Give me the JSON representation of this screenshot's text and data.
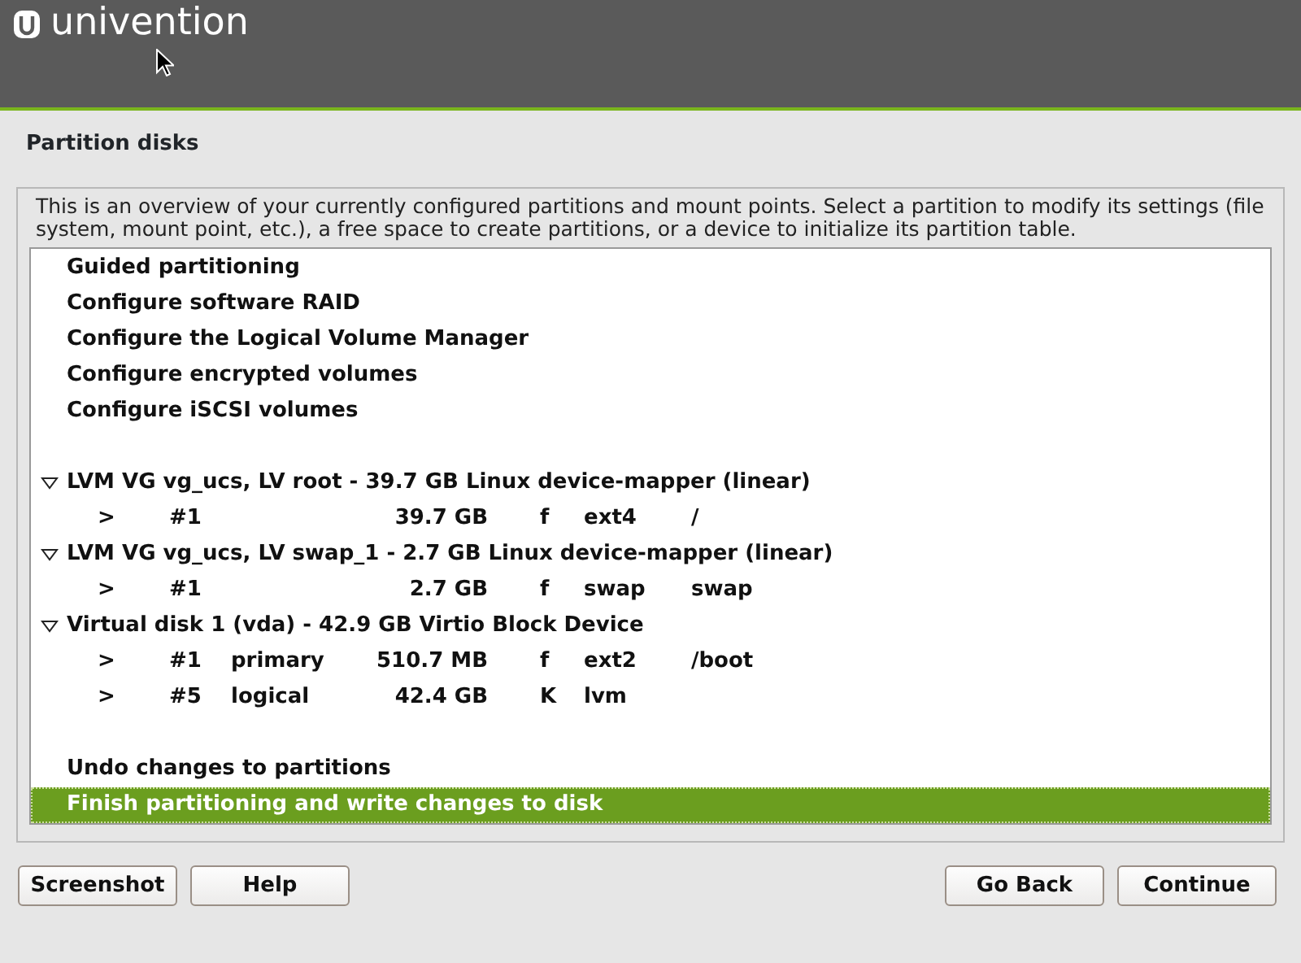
{
  "header": {
    "logo_text": "univention"
  },
  "title": "Partition disks",
  "description": "This is an overview of your currently configured partitions and mount points. Select a partition to modify its settings (file system, mount point, etc.), a free space to create partitions, or a device to initialize its partition table.",
  "items": [
    {
      "kind": "action",
      "label": "Guided partitioning",
      "selected": false
    },
    {
      "kind": "action",
      "label": "Configure software RAID",
      "selected": false
    },
    {
      "kind": "action",
      "label": "Configure the Logical Volume Manager",
      "selected": false
    },
    {
      "kind": "action",
      "label": "Configure encrypted volumes",
      "selected": false
    },
    {
      "kind": "action",
      "label": "Configure iSCSI volumes",
      "selected": false
    },
    {
      "kind": "blank"
    },
    {
      "kind": "device",
      "label": "LVM VG vg_ucs, LV root - 39.7 GB Linux device-mapper (linear)",
      "expanded": true,
      "selected": false
    },
    {
      "kind": "partition",
      "arrow": ">",
      "number": "#1",
      "size": "39.7 GB",
      "flag": "f",
      "fs": "ext4",
      "mount": "/",
      "selected": false
    },
    {
      "kind": "device",
      "label": "LVM VG vg_ucs, LV swap_1 - 2.7 GB Linux device-mapper (linear)",
      "expanded": true,
      "selected": false
    },
    {
      "kind": "partition",
      "arrow": ">",
      "number": "#1",
      "size": "2.7 GB",
      "flag": "f",
      "fs": "swap",
      "mount": "swap",
      "selected": false
    },
    {
      "kind": "device",
      "label": "Virtual disk 1 (vda) - 42.9 GB Virtio Block Device",
      "expanded": true,
      "selected": false
    },
    {
      "kind": "partition",
      "arrow": ">",
      "number": "#1",
      "type": "primary",
      "size": "510.7 MB",
      "flag": "f",
      "fs": "ext2",
      "mount": "/boot",
      "selected": false
    },
    {
      "kind": "partition",
      "arrow": ">",
      "number": "#5",
      "type": "logical",
      "size": "42.4 GB",
      "flag": "K",
      "fs": "lvm",
      "selected": false
    },
    {
      "kind": "blank"
    },
    {
      "kind": "action",
      "label": "Undo changes to partitions",
      "selected": false
    },
    {
      "kind": "action",
      "label": "Finish partitioning and write changes to disk",
      "selected": true
    }
  ],
  "buttons_left": [
    "Screenshot",
    "Help"
  ],
  "buttons_right": [
    "Go Back",
    "Continue"
  ]
}
